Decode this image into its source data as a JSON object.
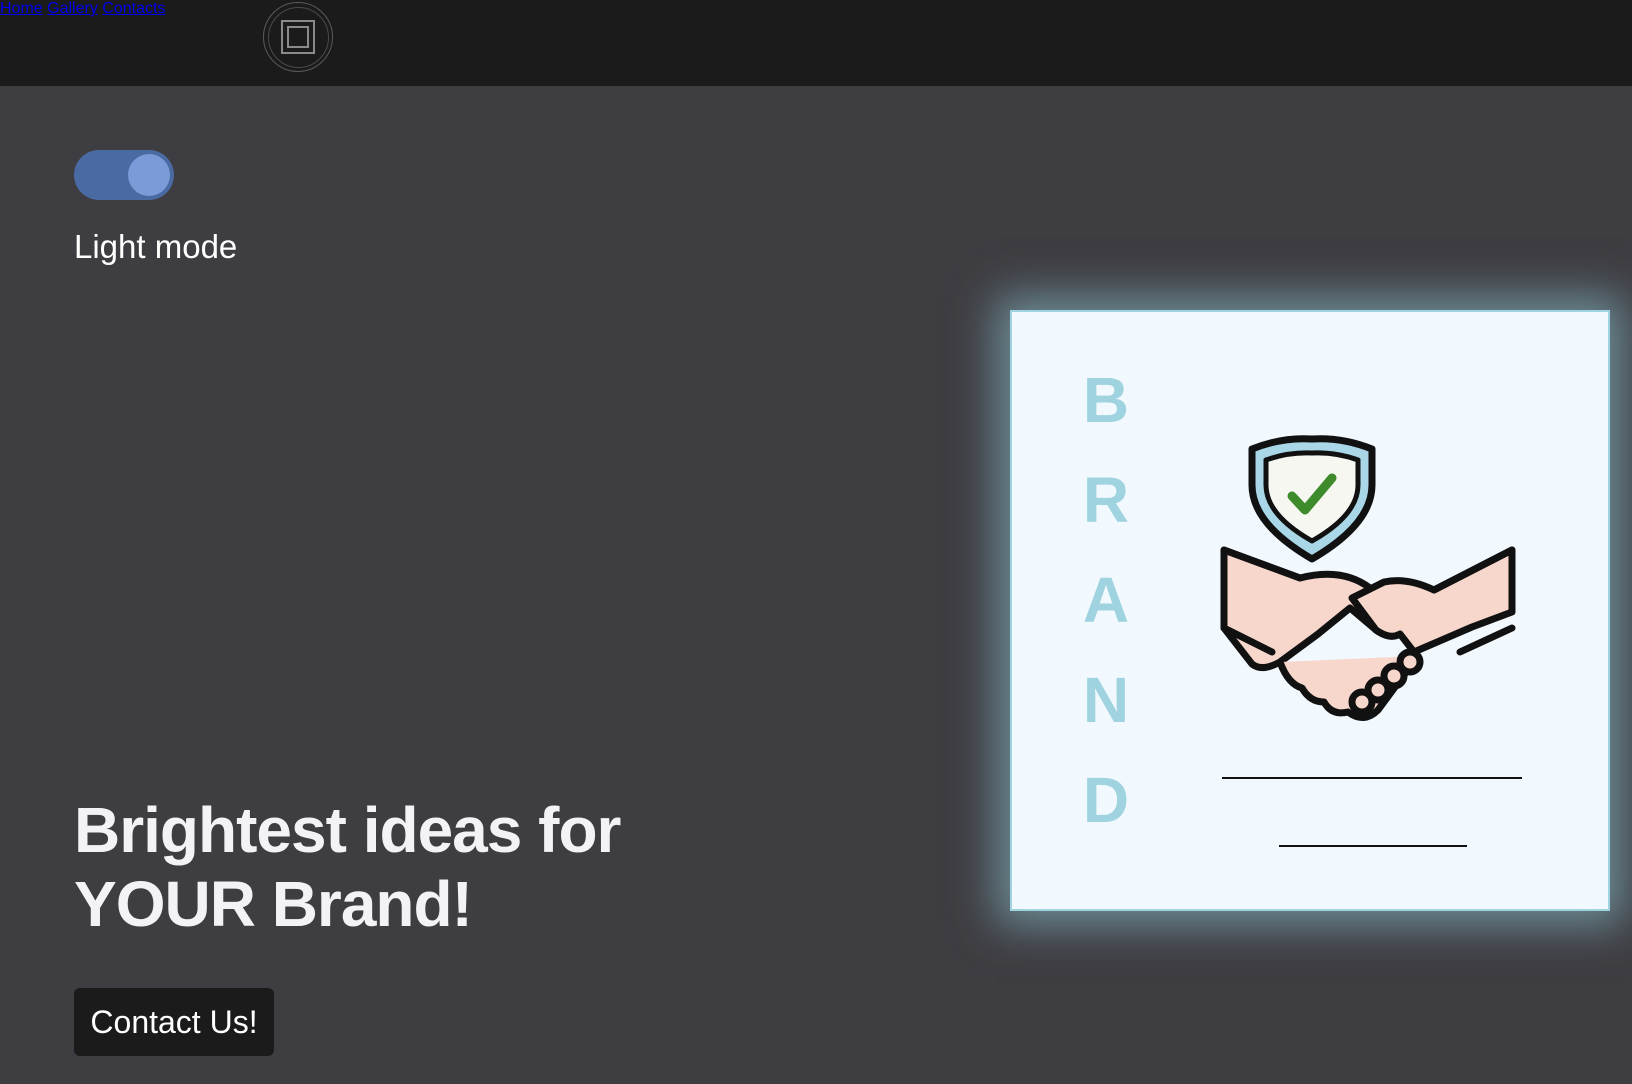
{
  "nav": {
    "logo_icon": "square-in-circle-logo",
    "links": [
      "Home",
      "Gallery",
      "Contacts"
    ]
  },
  "theme_toggle": {
    "state": "on",
    "label": "Light mode"
  },
  "hero": {
    "headline_line1": "Brightest ideas for",
    "headline_line2": "YOUR Brand!",
    "cta_label": "Contact Us!"
  },
  "card": {
    "letters": [
      "B",
      "R",
      "A",
      "N",
      "D"
    ],
    "illustration": "handshake-with-shield-check",
    "accent_color": "#9fd3df"
  }
}
